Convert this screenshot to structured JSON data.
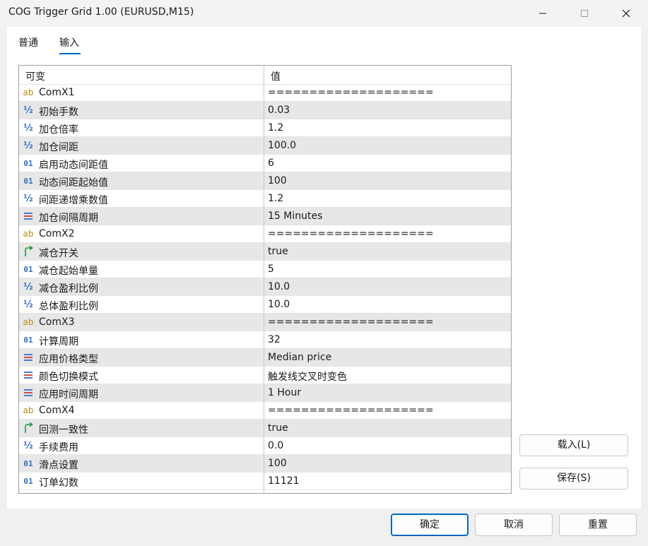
{
  "window": {
    "title": "COG Trigger Grid 1.00 (EURUSD,M15)"
  },
  "tabs": [
    {
      "label": "普通",
      "active": false
    },
    {
      "label": "输入",
      "active": true
    }
  ],
  "grid": {
    "header": {
      "name": "可变",
      "value": "值"
    },
    "rows": [
      {
        "icon": "ab",
        "name": "ComX1",
        "value": "===================="
      },
      {
        "icon": "half",
        "name": "初始手数",
        "value": "0.03"
      },
      {
        "icon": "half",
        "name": "加仓倍率",
        "value": "1.2"
      },
      {
        "icon": "half",
        "name": "加仓间距",
        "value": "100.0"
      },
      {
        "icon": "01",
        "name": "启用动态间距值",
        "value": "6"
      },
      {
        "icon": "01",
        "name": "动态间距起始值",
        "value": "100"
      },
      {
        "icon": "half",
        "name": "间距递增乘数值",
        "value": "1.2"
      },
      {
        "icon": "enum",
        "name": "加仓间隔周期",
        "value": "15 Minutes"
      },
      {
        "icon": "ab",
        "name": "ComX2",
        "value": "===================="
      },
      {
        "icon": "bool",
        "name": "减仓开关",
        "value": "true"
      },
      {
        "icon": "01",
        "name": "减仓起始单量",
        "value": "5"
      },
      {
        "icon": "half",
        "name": "减仓盈利比例",
        "value": "10.0"
      },
      {
        "icon": "half",
        "name": "总体盈利比例",
        "value": "10.0"
      },
      {
        "icon": "ab",
        "name": "ComX3",
        "value": "===================="
      },
      {
        "icon": "01",
        "name": "计算周期",
        "value": "32"
      },
      {
        "icon": "enum",
        "name": "应用价格类型",
        "value": "Median price"
      },
      {
        "icon": "enum",
        "name": "颜色切换模式",
        "value": "触发线交叉时变色"
      },
      {
        "icon": "enum",
        "name": "应用时间周期",
        "value": "1 Hour"
      },
      {
        "icon": "ab",
        "name": "ComX4",
        "value": "===================="
      },
      {
        "icon": "bool",
        "name": "回测一致性",
        "value": "true"
      },
      {
        "icon": "half",
        "name": "手续费用",
        "value": "0.0"
      },
      {
        "icon": "01",
        "name": "滑点设置",
        "value": "100"
      },
      {
        "icon": "01",
        "name": "订单幻数",
        "value": "11121"
      }
    ]
  },
  "side_buttons": {
    "load": "载入(L)",
    "save": "保存(S)"
  },
  "footer": {
    "ok": "确定",
    "cancel": "取消",
    "reset": "重置"
  },
  "colors": {
    "accent": "#0067c0",
    "row_alt": "#e7e7e7"
  }
}
